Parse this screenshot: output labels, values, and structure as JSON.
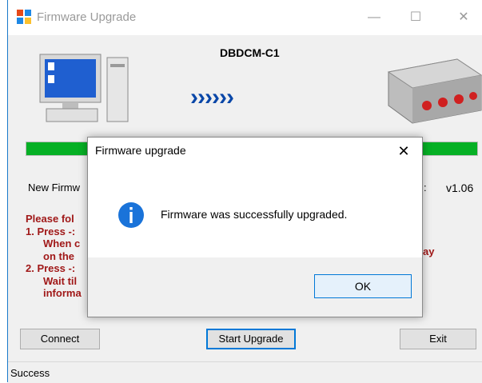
{
  "window": {
    "title": "Firmware Upgrade",
    "minimize_glyph": "—",
    "maximize_glyph": "☐",
    "close_glyph": "✕",
    "icon": "app-window-icon"
  },
  "header": {
    "device_name": "DBDCM-C1",
    "arrows": "››››››",
    "pc_icon": "computer-icon",
    "device_icon": "device-hardware-icon"
  },
  "progress": {
    "value": 1.0,
    "fill_color": "#06b025"
  },
  "firmware": {
    "label": "New Firmw",
    "colon": ":",
    "version": "v1.06"
  },
  "instructions": {
    "lines": [
      "Please fol",
      "1. Press -:",
      "When c",
      "on the ",
      "2. Press -:",
      "Wait til",
      "informa"
    ],
    "tail": "ay"
  },
  "buttons": {
    "connect": "Connect",
    "start_upgrade": "Start Upgrade",
    "exit": "Exit"
  },
  "status": {
    "text": "Success"
  },
  "dialog": {
    "title": "Firmware upgrade",
    "close_glyph": "✕",
    "icon": "information-icon",
    "message": "Firmware was successfully upgraded.",
    "ok_label": "OK"
  },
  "colors": {
    "accent": "#0078d7",
    "instruction_text": "#a01818",
    "arrow": "#0a47a8"
  }
}
